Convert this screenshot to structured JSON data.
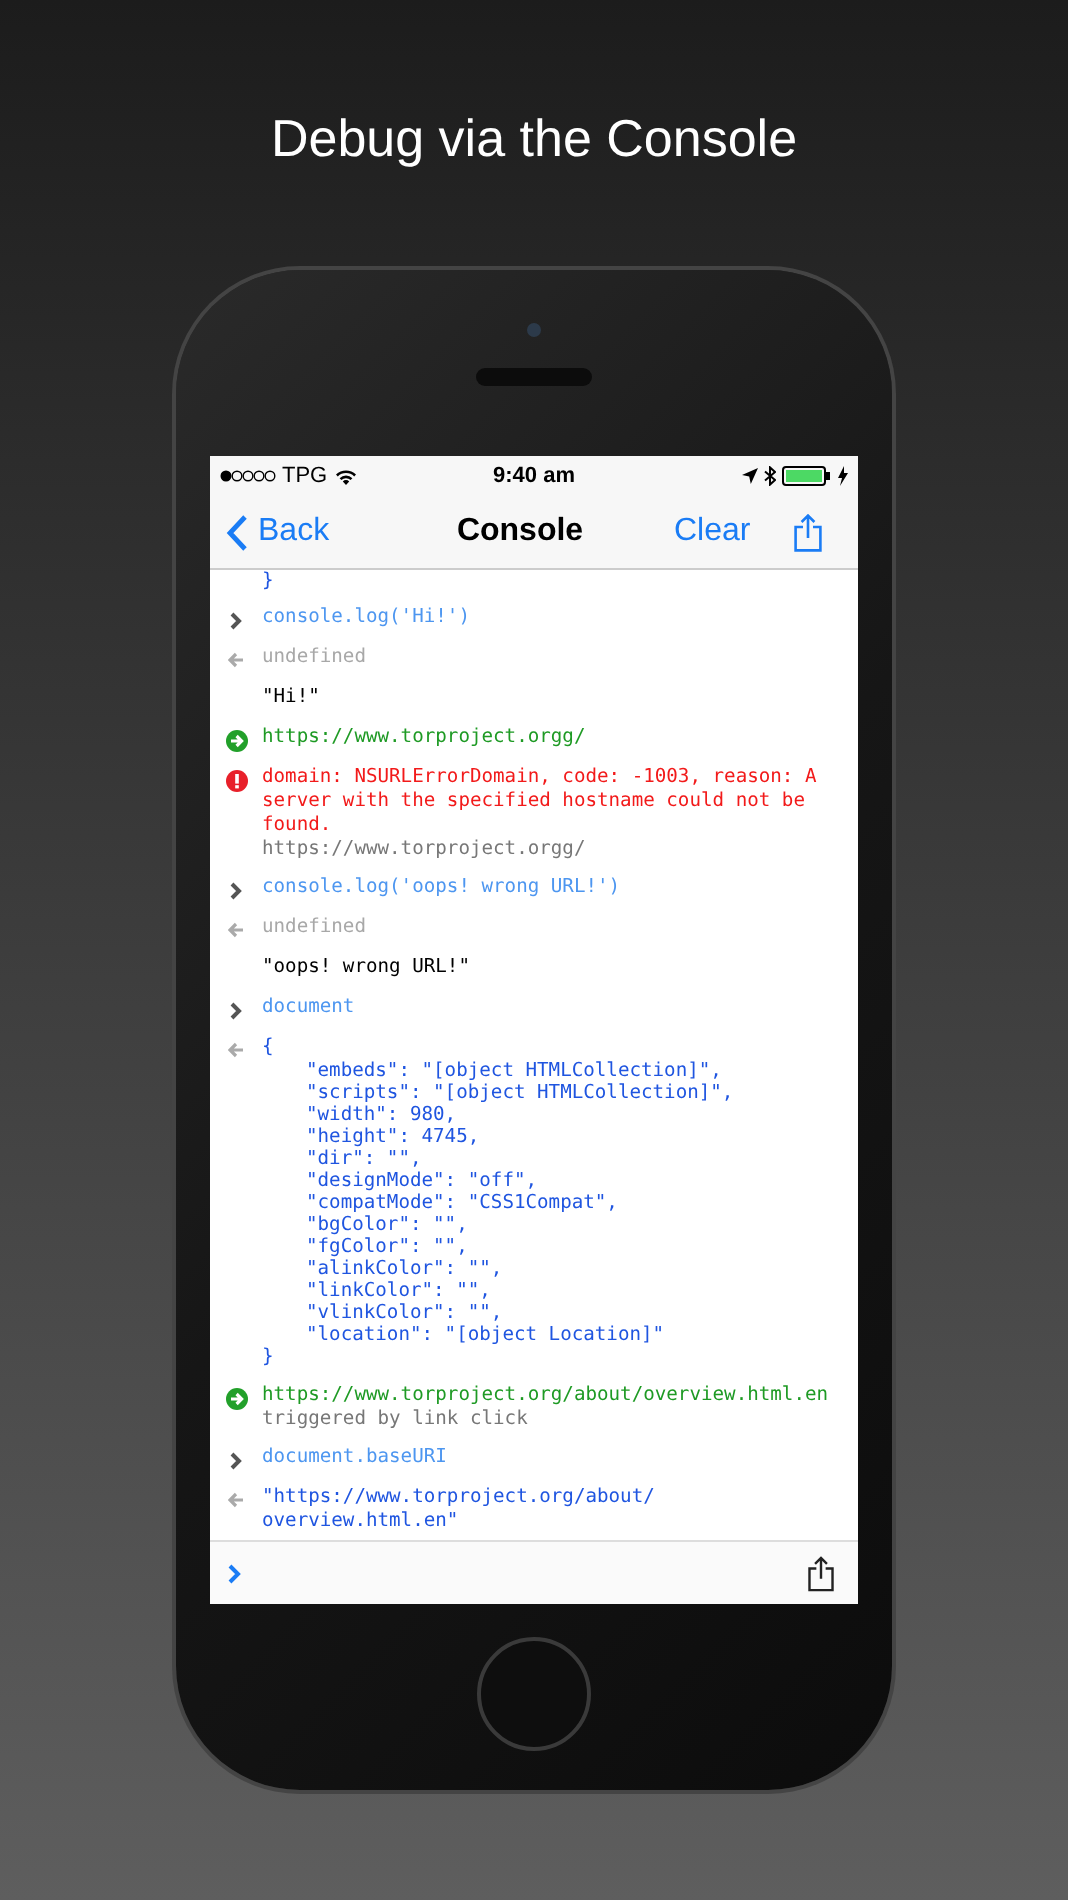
{
  "headline": "Debug via the Console",
  "status_bar": {
    "carrier": "TPG",
    "time": "9:40 am"
  },
  "nav_bar": {
    "back": "Back",
    "title": "Console",
    "action": "Clear"
  },
  "entries": [
    {
      "kind": "fragment",
      "lines": [
        "}"
      ]
    },
    {
      "kind": "input",
      "lines": [
        "console.log('Hi!')"
      ]
    },
    {
      "kind": "result",
      "lines": [
        "undefined"
      ]
    },
    {
      "kind": "output",
      "lines": [
        "\"Hi!\""
      ]
    },
    {
      "kind": "navigation",
      "lines": [
        "https://www.torproject.orgg/"
      ]
    },
    {
      "kind": "error",
      "lines": [
        "domain: NSURLErrorDomain, code: -1003, reason: A",
        "server with the specified hostname could not be",
        "found."
      ],
      "detail": "https://www.torproject.orgg/"
    },
    {
      "kind": "input",
      "lines": [
        "console.log('oops! wrong URL!')"
      ]
    },
    {
      "kind": "result",
      "lines": [
        "undefined"
      ]
    },
    {
      "kind": "output",
      "lines": [
        "\"oops! wrong URL!\""
      ]
    },
    {
      "kind": "input",
      "lines": [
        "document"
      ]
    },
    {
      "kind": "object",
      "open": "{",
      "members": [
        "\"embeds\": \"[object HTMLCollection]\",",
        "\"scripts\": \"[object HTMLCollection]\",",
        "\"width\": 980,",
        "\"height\": 4745,",
        "\"dir\": \"\",",
        "\"designMode\": \"off\",",
        "\"compatMode\": \"CSS1Compat\",",
        "\"bgColor\": \"\",",
        "\"fgColor\": \"\",",
        "\"alinkColor\": \"\",",
        "\"linkColor\": \"\",",
        "\"vlinkColor\": \"\",",
        "\"location\": \"[object Location]\""
      ],
      "close": "}"
    },
    {
      "kind": "navigation",
      "lines": [
        "https://www.torproject.org/about/overview.html.en"
      ],
      "detail": "triggered by link click"
    },
    {
      "kind": "input",
      "lines": [
        "document.baseURI"
      ]
    },
    {
      "kind": "value",
      "lines": [
        "\"https://www.torproject.org/about/",
        "overview.html.en\""
      ]
    }
  ]
}
